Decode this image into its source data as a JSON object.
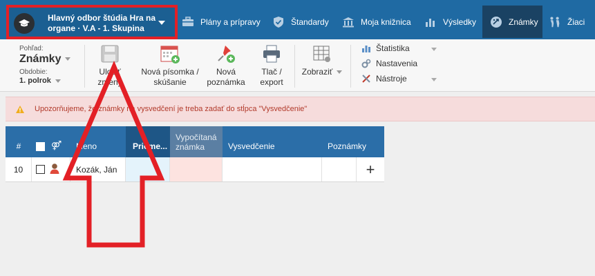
{
  "header": {
    "class_title": "Hlavný odbor štúdia Hra na organe · V.A - 1. Skupina",
    "nav": [
      {
        "label": "Plány a prípravy",
        "icon": "briefcase-icon"
      },
      {
        "label": "Štandardy",
        "icon": "shield-check-icon"
      },
      {
        "label": "Moja knižnica",
        "icon": "library-icon"
      },
      {
        "label": "Výsledky",
        "icon": "bar-chart-icon"
      },
      {
        "label": "Známky",
        "icon": "grade-icon"
      },
      {
        "label": "Žiaci",
        "icon": "students-icon"
      }
    ],
    "active_nav": "Známky"
  },
  "ribbon": {
    "view_label": "Pohľad:",
    "view_value": "Známky",
    "term_label": "Obdobie:",
    "term_value": "1. polrok",
    "save": "Uložiť zmeny",
    "new_test": "Nová písomka / skúšanie",
    "new_note": "Nová poznámka",
    "print": "Tlač / export",
    "display": "Zobraziť",
    "side": [
      "Štatistika",
      "Nastavenia",
      "Nástroje"
    ]
  },
  "alert": {
    "text": "Upozorňujeme, že známky na vysvedčení je treba zadať do stĺpca \"Vysvedčenie\""
  },
  "table": {
    "headers": {
      "num": "#",
      "name": "Meno",
      "avg": "Prieme...",
      "calc": "Vypočítaná známka",
      "report": "Vysvedčenie",
      "notes": "Poznámky"
    },
    "rows": [
      {
        "num": "10",
        "name": "Kozák, Ján",
        "avg": "",
        "calc": "",
        "report": "",
        "notes": ""
      }
    ]
  },
  "colors": {
    "nav": "#1f6aa3",
    "active_nav": "#1a4263",
    "table_header": "#2b6ea8",
    "highlight": "#e32026",
    "alert_bg": "#f6dcdc",
    "alert_text": "#b23a2b"
  }
}
